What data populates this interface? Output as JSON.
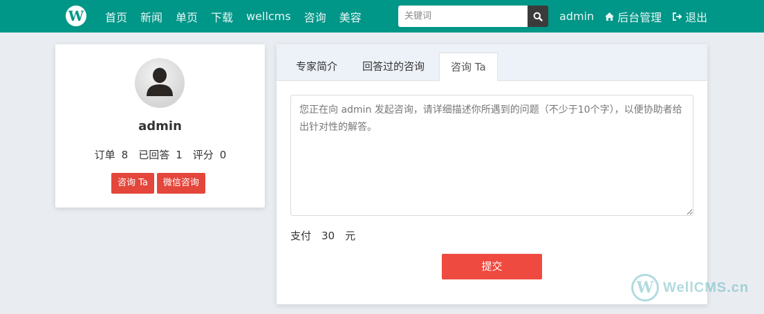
{
  "header": {
    "logo_letter": "W",
    "nav_items": [
      "首页",
      "新闻",
      "单页",
      "下载",
      "wellcms",
      "咨询",
      "美容"
    ],
    "search_placeholder": "关键词",
    "user": "admin",
    "admin_label": "后台管理",
    "logout_label": "退出"
  },
  "profile": {
    "username": "admin",
    "stats": [
      {
        "label": "订单",
        "value": "8"
      },
      {
        "label": "已回答",
        "value": "1"
      },
      {
        "label": "评分",
        "value": "0"
      }
    ],
    "consult_button": "咨询 Ta",
    "wechat_button": "微信咨询"
  },
  "main": {
    "tabs": [
      {
        "label": "专家简介"
      },
      {
        "label": "回答过的咨询"
      },
      {
        "label": "咨询 Ta"
      }
    ],
    "active_tab": 2,
    "textarea_placeholder": "您正在向 admin 发起咨询，请详细描述你所遇到的问题（不少于10个字），以便协助者给出针对性的解答。",
    "textarea_value": "",
    "pay_label": "支付",
    "pay_amount": "30",
    "pay_unit": "元",
    "submit_label": "提交"
  },
  "watermark": {
    "letter": "W",
    "text": "WellCMS.cn"
  },
  "colors": {
    "header_bg": "#009688",
    "button_red": "#e4463b",
    "submit_red": "#ef4a3f"
  }
}
